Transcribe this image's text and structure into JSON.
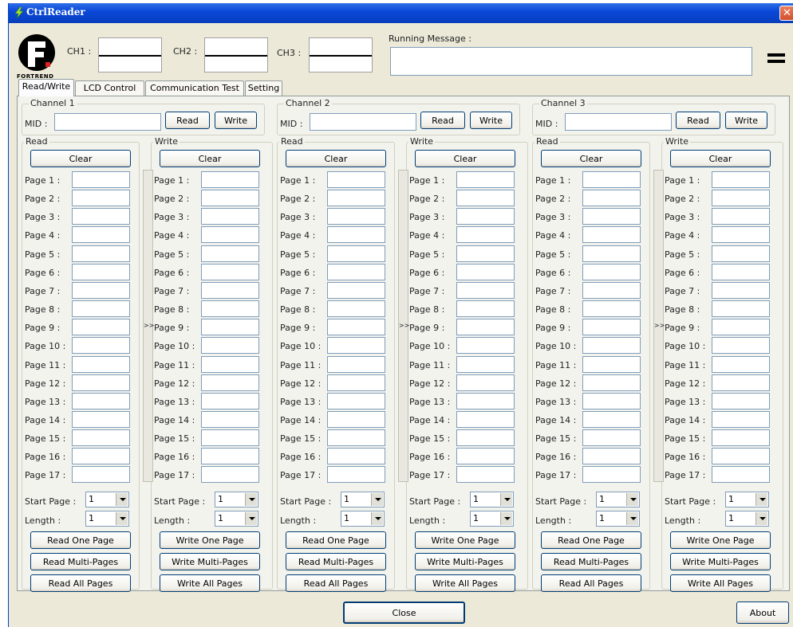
{
  "window": {
    "title": "CtrlReader",
    "close": "✕"
  },
  "logo": {
    "text": "FORTREND"
  },
  "header": {
    "ch1": "CH1 :",
    "ch2": "CH2 :",
    "ch3": "CH3 :",
    "running_label": "Running Message :"
  },
  "tabs": [
    {
      "label": "Read/Write",
      "active": true
    },
    {
      "label": "LCD Control",
      "active": false
    },
    {
      "label": "Communication Test",
      "active": false
    },
    {
      "label": "Setting",
      "active": false
    }
  ],
  "channels": [
    {
      "title": "Channel 1"
    },
    {
      "title": "Channel 2"
    },
    {
      "title": "Channel 3"
    }
  ],
  "labels": {
    "mid": "MID :",
    "read_btn": "Read",
    "write_btn": "Write",
    "read_group": "Read",
    "write_group": "Write",
    "clear": "Clear",
    "start_page": "Start Page :",
    "length": "Length :",
    "read_one": "Read One Page",
    "read_multi": "Read Multi-Pages",
    "read_all": "Read All Pages",
    "write_one": "Write One Page",
    "write_multi": "Write Multi-Pages",
    "write_all": "Write All Pages",
    "transfer": ">>"
  },
  "pages": [
    "Page 1 :",
    "Page 2 :",
    "Page 3 :",
    "Page 4 :",
    "Page 5 :",
    "Page 6 :",
    "Page 7 :",
    "Page 8 :",
    "Page 9 :",
    "Page 10 :",
    "Page 11 :",
    "Page 12 :",
    "Page 13 :",
    "Page 14 :",
    "Page 15 :",
    "Page 16 :",
    "Page 17 :"
  ],
  "selects": {
    "start_page": "1",
    "length": "1"
  },
  "footer": {
    "close": "Close",
    "about": "About"
  }
}
